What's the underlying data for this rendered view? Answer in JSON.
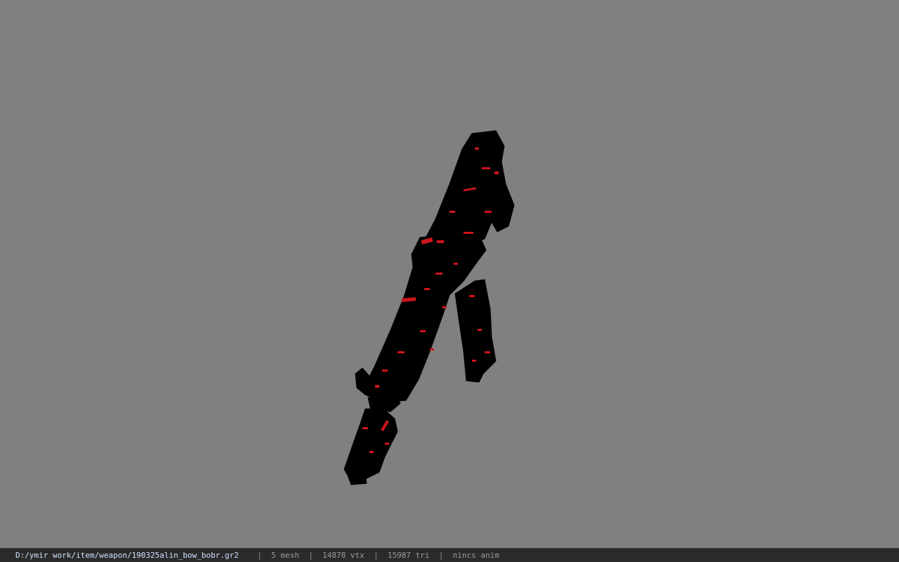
{
  "viewport": {
    "background_color": "#808080",
    "model": {
      "name": "weapon-model",
      "body_color": "#000000",
      "texture_accent_color": "#d0141b"
    }
  },
  "statusbar": {
    "file_path": "D:/ymir work/item/weapon/190325alin_bow_bobr.gr2",
    "separator": "|",
    "mesh_count": "5 mesh",
    "vertex_count": "14878 vtx",
    "triangle_count": "15987 tri",
    "anim_status": "nincs anim"
  }
}
